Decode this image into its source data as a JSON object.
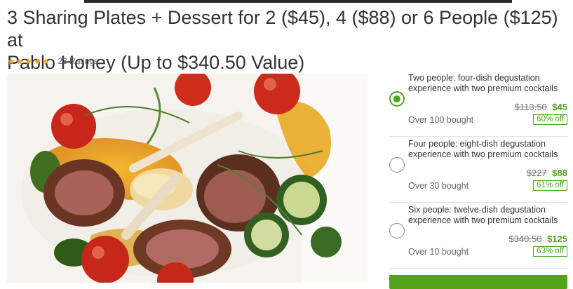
{
  "deal": {
    "title_line1": "3 Sharing Plates + Dessert for 2 ($45), 4 ($88) or 6 People ($125) at",
    "title_line2": "Pablo Honey (Up to $340.50 Value)",
    "rating": {
      "stars": 5,
      "ratings_label": "23 Ratings"
    }
  },
  "options": [
    {
      "line1": "Two people: four-dish degustation",
      "line2": "experience with two premium cocktails",
      "original_price": "$113.50",
      "price": "$45",
      "bought": "Over 100 bought",
      "discount": "60% off",
      "selected": true
    },
    {
      "line1": "Four people: eight-dish degustation",
      "line2": "experience with two premium cocktails",
      "original_price": "$227",
      "price": "$88",
      "bought": "Over 30 bought",
      "discount": "61% off",
      "selected": false
    },
    {
      "line1": "Six people: twelve-dish degustation",
      "line2": "experience with two premium cocktails",
      "original_price": "$340.50",
      "price": "$125",
      "bought": "Over 10 bought",
      "discount": "63% off",
      "selected": false
    }
  ],
  "colors": {
    "accent_green": "#4ca61f",
    "star": "#f5a623",
    "button": "#53a318"
  },
  "icons": {
    "rating": "star-icon",
    "option_selector": "radio-icon"
  }
}
